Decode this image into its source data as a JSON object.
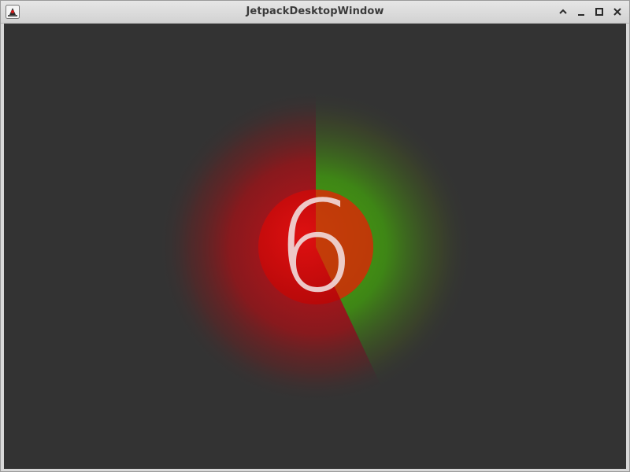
{
  "window": {
    "title": "JetpackDesktopWindow",
    "icon": "java-duke-icon",
    "controls": [
      {
        "name": "collapse",
        "icon": "chevron-up-icon"
      },
      {
        "name": "minimize",
        "icon": "minimize-icon"
      },
      {
        "name": "maximize",
        "icon": "maximize-icon"
      },
      {
        "name": "close",
        "icon": "close-icon"
      }
    ]
  },
  "countdown": {
    "value": "6",
    "progress_fraction": 0.43,
    "colors": {
      "background": "#333333",
      "elapsed": "#c8101a",
      "remaining": "#4aa80e",
      "digit": "#f0d8d8"
    }
  }
}
